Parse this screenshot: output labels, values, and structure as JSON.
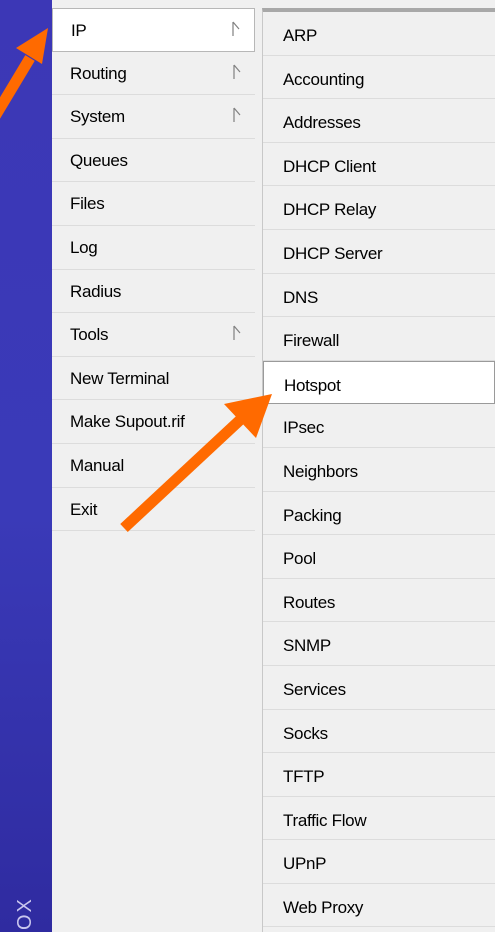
{
  "brand": {
    "text": "OX"
  },
  "main_menu": {
    "items": [
      {
        "label": "IP",
        "has_submenu": true,
        "selected": true
      },
      {
        "label": "Routing",
        "has_submenu": true
      },
      {
        "label": "System",
        "has_submenu": true
      },
      {
        "label": "Queues"
      },
      {
        "label": "Files"
      },
      {
        "label": "Log"
      },
      {
        "label": "Radius"
      },
      {
        "label": "Tools",
        "has_submenu": true
      },
      {
        "label": "New Terminal"
      },
      {
        "label": "Make Supout.rif"
      },
      {
        "label": "Manual"
      },
      {
        "label": "Exit"
      }
    ]
  },
  "ip_submenu": {
    "items": [
      {
        "label": "ARP"
      },
      {
        "label": "Accounting"
      },
      {
        "label": "Addresses"
      },
      {
        "label": "DHCP Client"
      },
      {
        "label": "DHCP Relay"
      },
      {
        "label": "DHCP Server"
      },
      {
        "label": "DNS"
      },
      {
        "label": "Firewall"
      },
      {
        "label": "Hotspot",
        "highlighted": true
      },
      {
        "label": "IPsec"
      },
      {
        "label": "Neighbors"
      },
      {
        "label": "Packing"
      },
      {
        "label": "Pool"
      },
      {
        "label": "Routes"
      },
      {
        "label": "SNMP"
      },
      {
        "label": "Services"
      },
      {
        "label": "Socks"
      },
      {
        "label": "TFTP"
      },
      {
        "label": "Traffic Flow"
      },
      {
        "label": "UPnP"
      },
      {
        "label": "Web Proxy"
      }
    ]
  },
  "annotations": {
    "arrow_color": "#ff6a00",
    "arrows": [
      "arrow-to-ip",
      "arrow-to-hotspot"
    ]
  },
  "colors": {
    "sidebar_blue": "#3a38b5",
    "menu_bg": "#f0f0f0",
    "highlight_bg": "#ffffff"
  }
}
